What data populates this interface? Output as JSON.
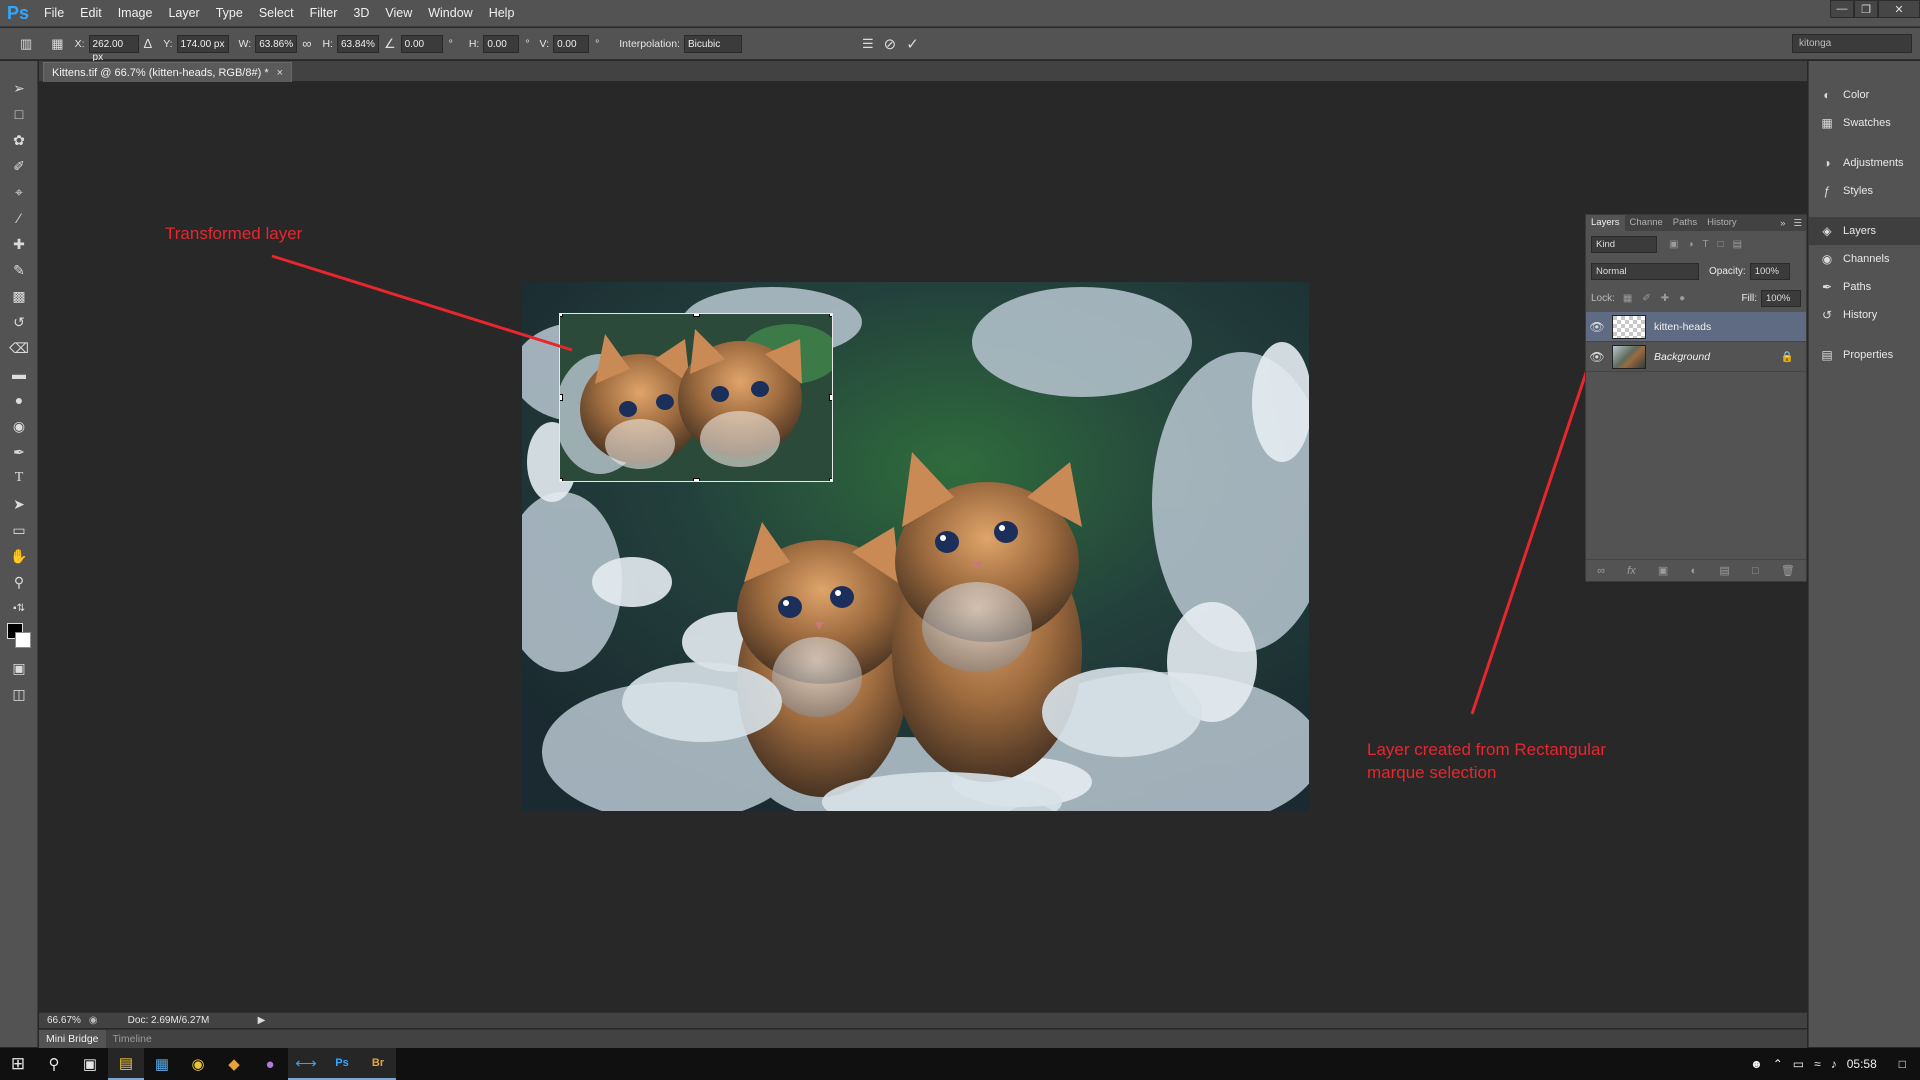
{
  "app": {
    "logo": "Ps",
    "menu": [
      "File",
      "Edit",
      "Image",
      "Layer",
      "Type",
      "Select",
      "Filter",
      "3D",
      "View",
      "Window",
      "Help"
    ]
  },
  "options_bar": {
    "x_label": "X:",
    "x_value": "262.00 px",
    "y_label": "Y:",
    "y_value": "174.00 px",
    "w_label": "W:",
    "w_value": "63.86%",
    "h_label": "H:",
    "h_value": "63.84%",
    "angle_value": "0.00",
    "angle_unit": "°",
    "hskew_label": "H:",
    "hskew_value": "0.00",
    "vskew_label": "V:",
    "vskew_value": "0.00",
    "interp_label": "Interpolation:",
    "interp_value": "Bicubic",
    "workspace": "kitonga"
  },
  "document": {
    "tab_title": "Kittens.tif @ 66.7% (kitten-heads, RGB/8#) *",
    "close_glyph": "×"
  },
  "status": {
    "zoom": "66.67%",
    "doc_info": "Doc: 2.69M/6.27M"
  },
  "bottom_tabs": [
    "Mini Bridge",
    "Timeline"
  ],
  "dock": {
    "items": [
      "Color",
      "Swatches",
      "Adjustments",
      "Styles",
      "Layers",
      "Channels",
      "Paths",
      "History",
      "Properties"
    ]
  },
  "layers_panel": {
    "tabs": [
      "Layers",
      "Channe",
      "Paths",
      "History"
    ],
    "kind": "Kind",
    "blend_mode": "Normal",
    "opacity_label": "Opacity:",
    "opacity_value": "100%",
    "lock_label": "Lock:",
    "fill_label": "Fill:",
    "fill_value": "100%",
    "layers": [
      {
        "name": "kitten-heads",
        "selected": true
      },
      {
        "name": "Background",
        "selected": false
      }
    ]
  },
  "annotations": {
    "transformed": "Transformed layer",
    "created_line1": "Layer created from Rectangular",
    "created_line2": "marque selection",
    "color": "#e8262e"
  },
  "taskbar": {
    "time": "05:58"
  },
  "colors": {
    "accent": "#31a8ff",
    "selected_layer": "#5f6b82"
  }
}
